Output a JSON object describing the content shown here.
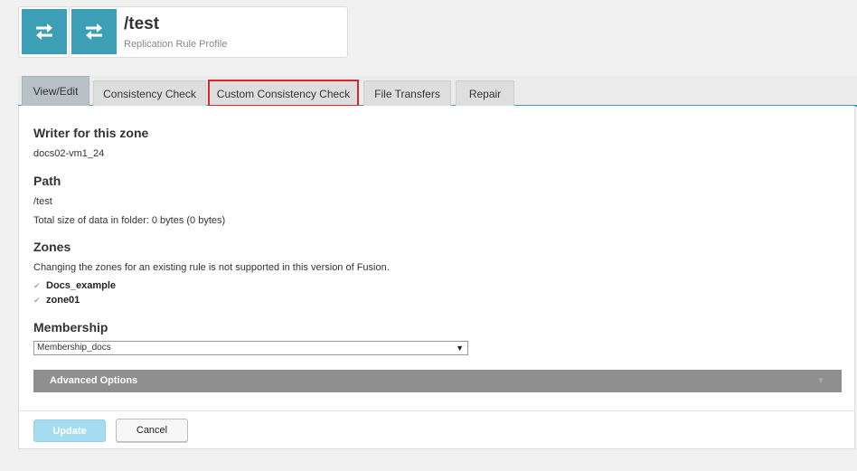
{
  "header": {
    "title": "/test",
    "subtitle": "Replication Rule Profile",
    "icon": "replication-arrows-icon",
    "accent": "#3d9fb5"
  },
  "tabs": [
    {
      "label": "View/Edit",
      "active": true
    },
    {
      "label": "Consistency Check",
      "active": false
    },
    {
      "label": "Custom Consistency Check",
      "active": false,
      "highlighted": true
    },
    {
      "label": "File Transfers",
      "active": false
    },
    {
      "label": "Repair",
      "active": false
    }
  ],
  "writer": {
    "heading": "Writer for this zone",
    "value": "docs02-vm1_24"
  },
  "path": {
    "heading": "Path",
    "value": "/test",
    "size_text": "Total size of data in folder: 0 bytes (0 bytes)"
  },
  "zones": {
    "heading": "Zones",
    "note": "Changing the zones for an existing rule is not supported in this version of Fusion.",
    "items": [
      {
        "label": "Docs_example",
        "checked": true
      },
      {
        "label": "zone01",
        "checked": true
      }
    ]
  },
  "membership": {
    "heading": "Membership",
    "selected": "Membership_docs"
  },
  "advanced": {
    "label": "Advanced Options"
  },
  "buttons": {
    "update": "Update",
    "cancel": "Cancel"
  }
}
